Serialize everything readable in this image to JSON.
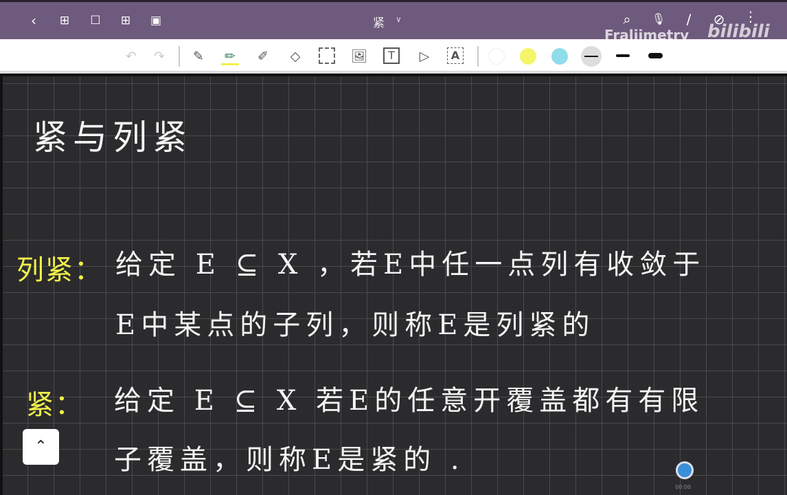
{
  "topbar": {
    "title": "紧",
    "watermark": "Fraljimetry",
    "logo": "bilibili",
    "icons": [
      "back-icon",
      "grid-icon",
      "bookmark-icon",
      "add-page-icon",
      "crop-icon",
      "search-icon",
      "mic-icon",
      "pen-icon",
      "hide-icon",
      "more-icon"
    ]
  },
  "toolbar": {
    "colors": [
      "#ffffff",
      "#f5f56a",
      "#8fdcea"
    ],
    "tools": [
      "undo",
      "redo",
      "pen",
      "ballpoint",
      "highlighter",
      "eraser",
      "lasso",
      "image",
      "text",
      "shape",
      "text-recognition"
    ]
  },
  "note": {
    "heading": "紧与列紧",
    "def1_label": "列紧：",
    "def1_line1": "给定 E ⊆ X ，若E中任一点列有收敛于",
    "def1_line2": "E中某点的子列，则称E是列紧的",
    "def2_label": "紧：",
    "def2_line1": "给定 E ⊆ X  若E的任意开覆盖都有有限",
    "def2_line2": "子覆盖，则称E是紧的 ."
  },
  "scroll_label": "00:00"
}
